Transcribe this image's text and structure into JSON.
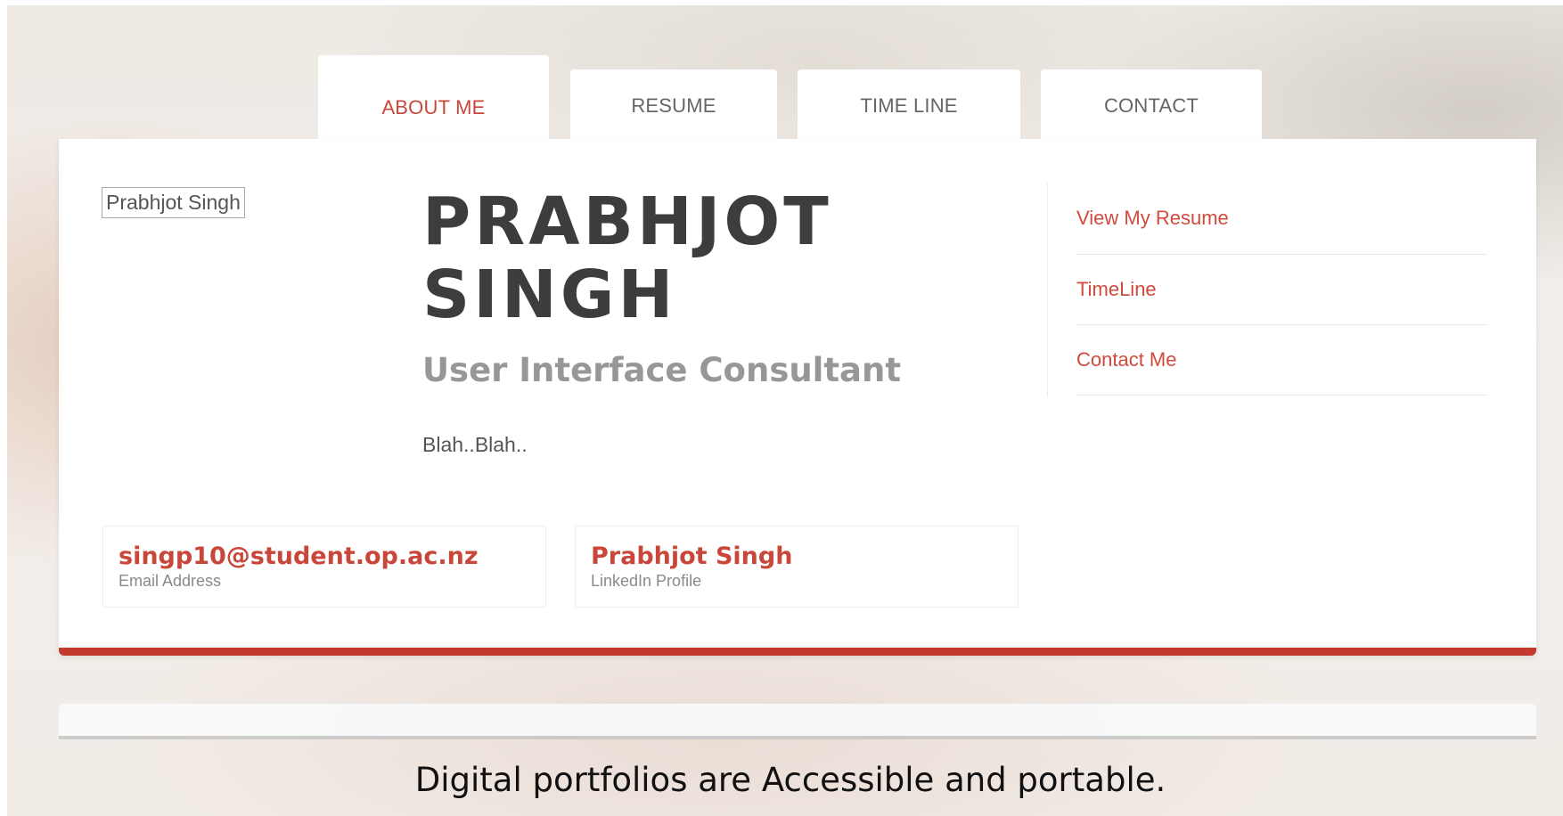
{
  "tabs": [
    {
      "label": "ABOUT ME",
      "active": true
    },
    {
      "label": "RESUME",
      "active": false
    },
    {
      "label": "TIME LINE",
      "active": false
    },
    {
      "label": "CONTACT",
      "active": false
    }
  ],
  "profile": {
    "photo_alt": "Prabhjot Singh",
    "name": "PRABHJOT SINGH",
    "role": "User Interface Consultant",
    "bio": "Blah..Blah.."
  },
  "sidebar": {
    "links": [
      {
        "label": "View My Resume"
      },
      {
        "label": "TimeLine"
      },
      {
        "label": "Contact Me"
      }
    ]
  },
  "contact": {
    "email": {
      "value": "singp10@student.op.ac.nz",
      "label": "Email Address"
    },
    "linkedin": {
      "value": "Prabhjot Singh",
      "label": "LinkedIn Profile"
    }
  },
  "caption": "Digital portfolios are Accessible and portable.",
  "colors": {
    "accent": "#c9473a",
    "card_border": "#c23a2e",
    "name_text": "#3d3d3d",
    "role_text": "#979797"
  }
}
